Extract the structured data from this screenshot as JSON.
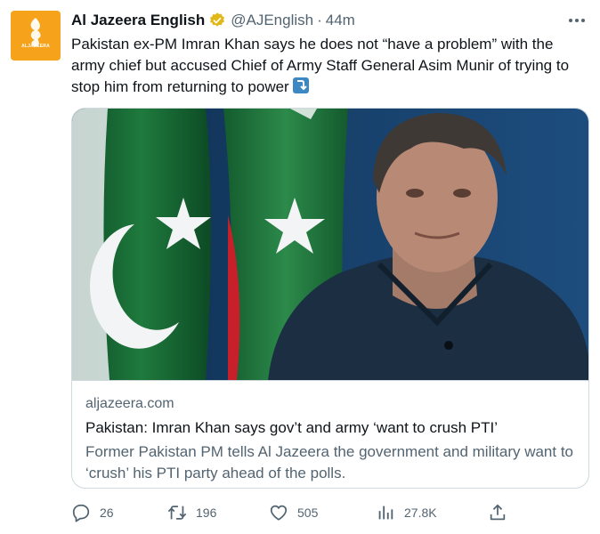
{
  "tweet": {
    "author_name": "Al Jazeera English",
    "handle": "@AJEnglish",
    "separator": "·",
    "time": "44m",
    "text": "Pakistan ex-PM Imran Khan says he does not “have a problem” with the army chief but accused Chief of Army Staff General Asim Munir of trying to stop him from returning to power",
    "avatar_label": "ALJAZEERA"
  },
  "card": {
    "domain": "aljazeera.com",
    "title": "Pakistan: Imran Khan says gov’t and army ‘want to crush PTI’",
    "description": "Former Pakistan PM tells Al Jazeera the government and military want to ‘crush’ his PTI party ahead of the polls."
  },
  "actions": {
    "replies": "26",
    "retweets": "196",
    "likes": "505",
    "views": "27.8K"
  },
  "colors": {
    "brand_orange": "#f7a21b",
    "verified_gold": "#e2b719",
    "muted_text": "#536471",
    "border": "#cfd9de"
  },
  "icons": [
    "more-icon",
    "verified-badge-icon",
    "reply-icon",
    "retweet-icon",
    "like-icon",
    "views-icon",
    "share-icon"
  ]
}
